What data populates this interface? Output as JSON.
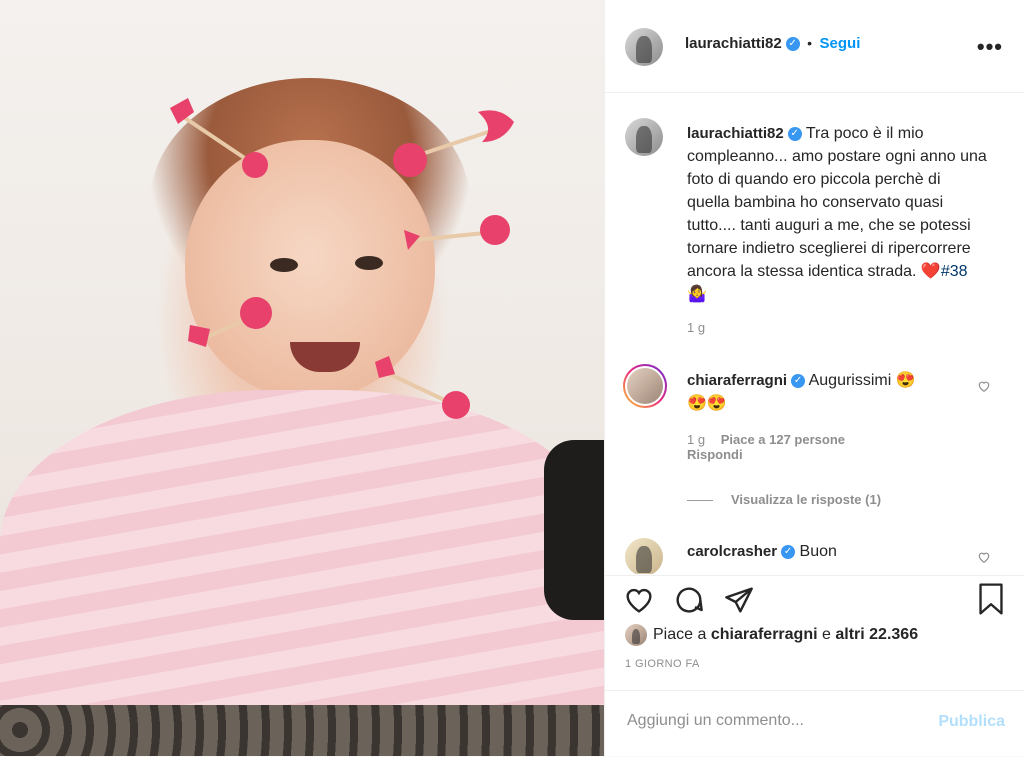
{
  "post": {
    "author": "laurachiatti82",
    "follow_label": "Segui",
    "more_label": "•••",
    "bullet": "•",
    "caption_text": "Tra poco è il mio compleanno... amo postare ogni anno una foto di quando ero piccola perchè di quella bambina ho conservato quasi tutto.... tanti auguri a me, che se potessi tornare indietro sceglierei di ripercorrere ancora la stessa identica strada.",
    "caption_emoji": "❤️",
    "caption_hashtag": "#38",
    "caption_emoji_end": "🤷‍♀️",
    "caption_time": "1 g"
  },
  "comments": [
    {
      "user": "chiaraferragni",
      "text": "Augurissimi 😍",
      "text_line2": "😍😍",
      "time": "1 g",
      "likes": "Piace a 127 persone",
      "reply": "Rispondi",
      "view_replies": "Visualizza le risposte (1)",
      "replies_line": "——"
    },
    {
      "user": "carolcrasher",
      "text": "Buon"
    }
  ],
  "likes_line": {
    "prefix": "Piace a",
    "user": "chiaraferragni",
    "middle": "e",
    "others": "altri 22.366"
  },
  "date_label": "1 GIORNO FA",
  "add_comment": {
    "placeholder": "Aggiungi un commento...",
    "publish": "Pubblica"
  },
  "icons": {
    "verified": "verified-badge-icon",
    "like": "heart-icon",
    "comment": "comment-bubble-icon",
    "share": "paper-plane-icon",
    "save": "bookmark-icon"
  },
  "colors": {
    "accent": "#0095f6",
    "verified": "#3897f0",
    "publish_disabled": "#b2dffc",
    "arrow_hearts": "#e8416b"
  }
}
